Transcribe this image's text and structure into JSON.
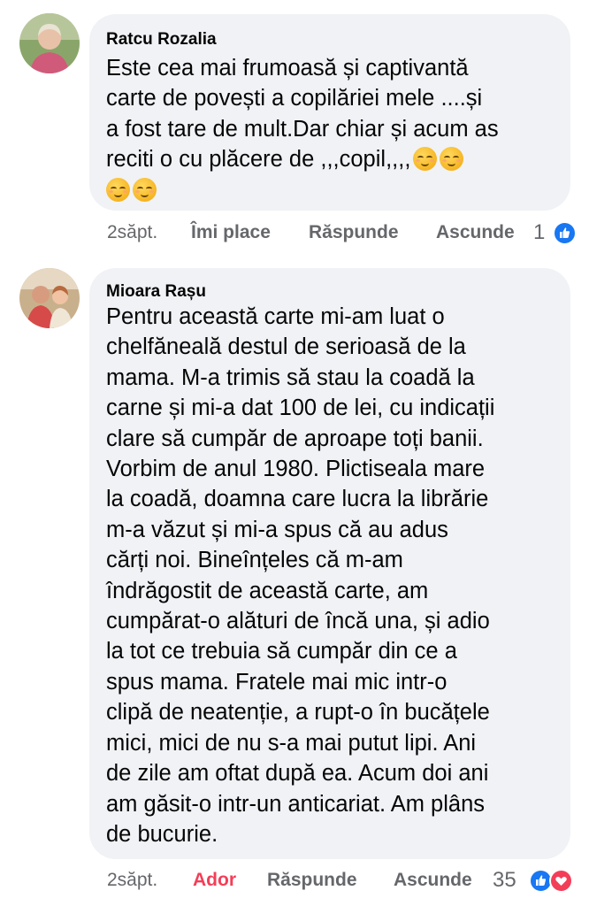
{
  "comments": [
    {
      "author": "Ratcu Rozalia",
      "text": "Este cea mai frumoasă și captivantă\ncarte de povești a copilăriei mele ....și\na fost tare de mult.Dar chiar și acum as\nreciti o cu plăcere de ,,,copil,,,,",
      "emojis": [
        "smiling-face-emoji",
        "smiling-face-emoji",
        "smiling-face-emoji",
        "smiling-face-emoji"
      ],
      "time": "2săpt.",
      "action_react": "Îmi place",
      "action_reply": "Răspunde",
      "action_hide": "Ascunde",
      "reaction_count": "1",
      "reactions": [
        "like-icon"
      ]
    },
    {
      "author": "Mioara Rașu",
      "text": "Pentru această carte mi-am luat o\nchelfăneală destul de serioasă de la\nmama. M-a trimis să stau la coadă la\ncarne și mi-a dat 100 de lei, cu indicații\nclare să cumpăr de aproape toți  banii.\nVorbim de anul 1980. Plictiseala mare\nla coadă,  doamna care lucra la librărie\nm-a văzut și mi-a spus că au adus\ncărți noi. Bineînțeles că m-am\nîndrăgostit de această carte, am\ncumpărat-o alături de încă una, și adio\nla tot ce trebuia să cumpăr din ce a\nspus mama. Fratele mai mic intr-o\nclipă de neatenție, a rupt-o în bucățele\nmici, mici de nu s-a mai putut lipi. Ani\nde zile am oftat după ea. Acum doi ani\nam găsit-o intr-un anticariat. Am plâns\nde bucurie.",
      "time": "2săpt.",
      "action_react": "Ador",
      "action_reply": "Răspunde",
      "action_hide": "Ascunde",
      "reaction_count": "35",
      "reactions": [
        "like-icon",
        "love-icon"
      ]
    }
  ],
  "colors": {
    "bubble": "#f0f2f5",
    "meta_text": "#65676b",
    "like_blue": "#1877f2",
    "love_red": "#f33e58"
  }
}
